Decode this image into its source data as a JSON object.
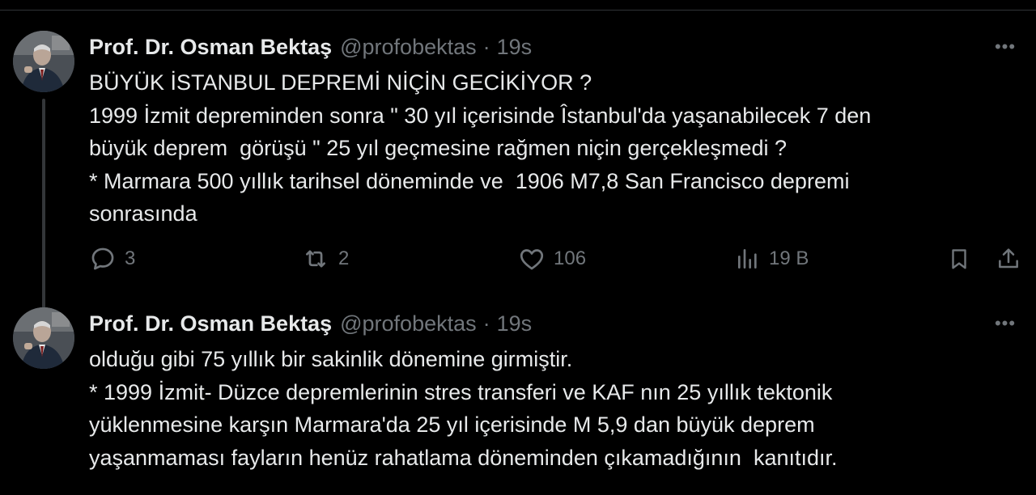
{
  "tweets": [
    {
      "author_name": "Prof. Dr. Osman Bektaş",
      "handle": "@profobektas",
      "separator": "·",
      "time": "19s",
      "more": "•••",
      "lines": [
        "BÜYÜK İSTANBUL DEPREMİ NİÇİN GECİKİYOR ?",
        "1999 İzmit depreminden sonra \" 30 yıl içerisinde Îstanbul'da yaşanabilecek 7 den",
        "büyük deprem  görüşü \" 25 yıl geçmesine rağmen niçin gerçekleşmedi ?",
        "* Marmara 500 yıllık tarihsel döneminde ve  1906 M7,8 San Francisco depremi",
        "sonrasında"
      ],
      "actions": {
        "replies": "3",
        "retweets": "2",
        "likes": "106",
        "views": "19 B"
      }
    },
    {
      "author_name": "Prof. Dr. Osman Bektaş",
      "handle": "@profobektas",
      "separator": "·",
      "time": "19s",
      "more": "•••",
      "lines": [
        "olduğu gibi 75 yıllık bir sakinlik dönemine girmiştir.",
        "* 1999 İzmit- Düzce depremlerinin stres transferi ve KAF nın 25 yıllık tektonik",
        "yüklenmesine karşın Marmara'da 25 yıl içerisinde M 5,9 dan büyük deprem",
        "yaşanmaması fayların henüz rahatlama döneminden çıkamadığının  kanıtıdır."
      ]
    }
  ],
  "colors": {
    "background": "#000000",
    "text": "#e7e9ea",
    "muted": "#71767b",
    "divider": "#2f3336"
  },
  "icons": [
    "more-icon",
    "reply-icon",
    "retweet-icon",
    "like-icon",
    "views-icon",
    "bookmark-icon",
    "share-icon"
  ]
}
